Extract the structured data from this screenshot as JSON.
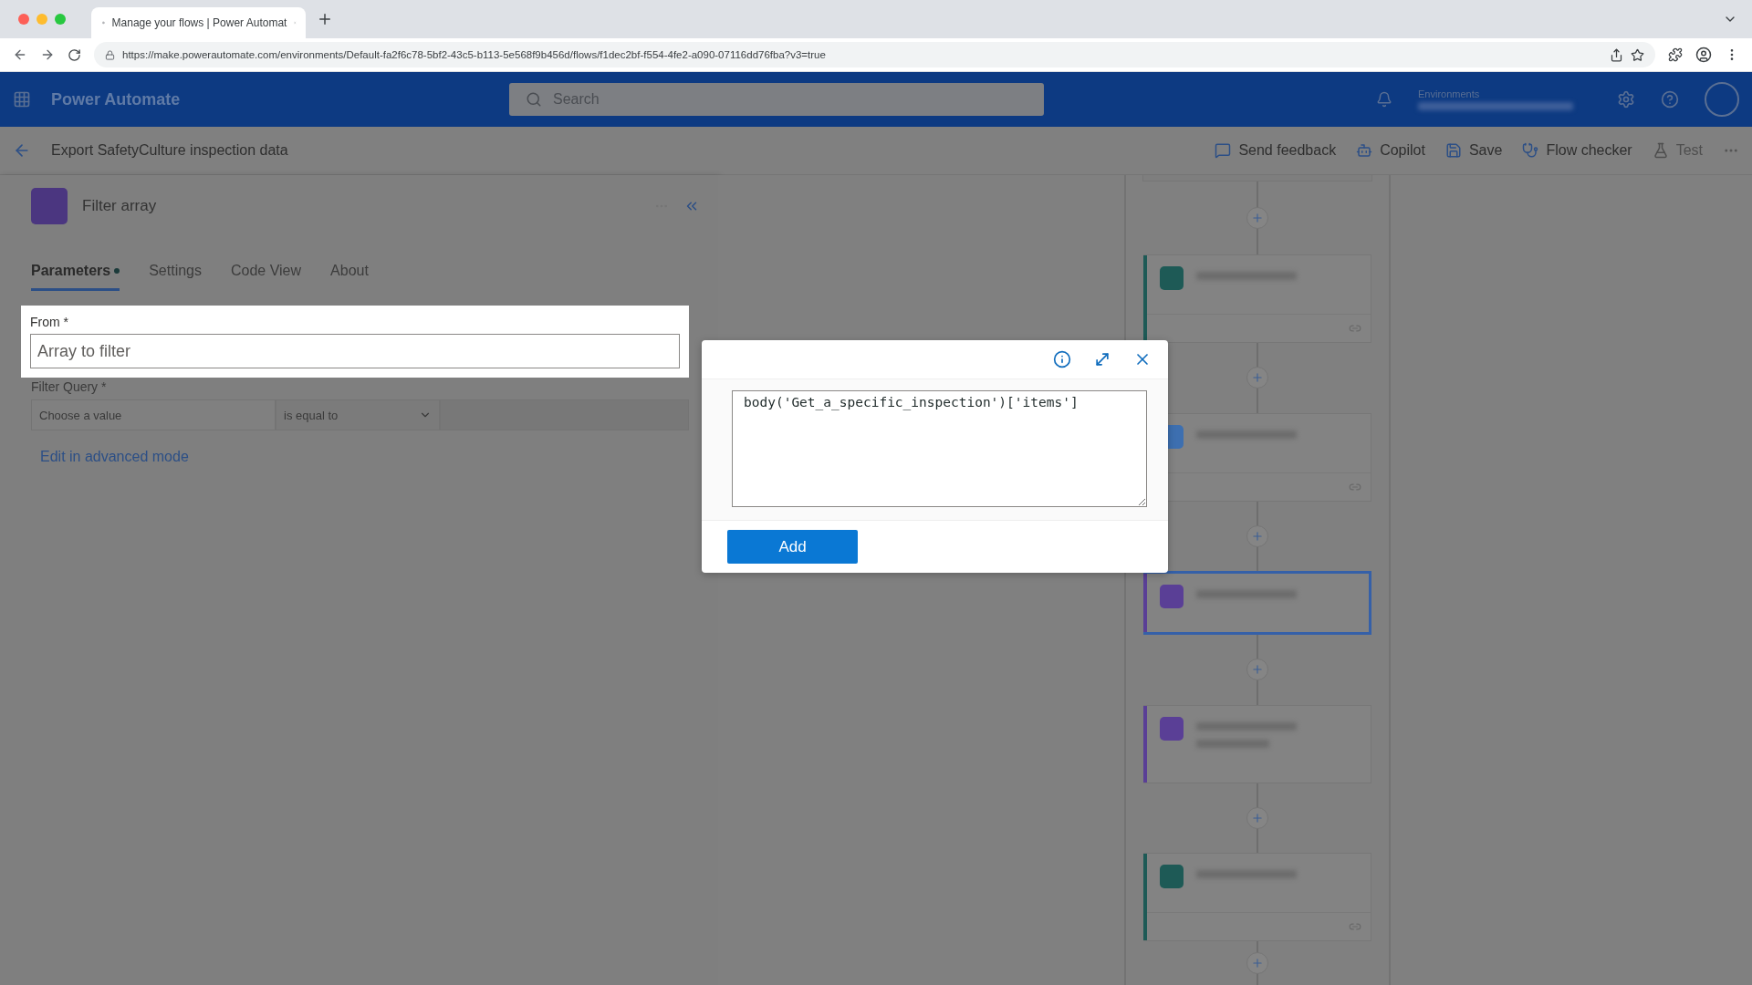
{
  "browser": {
    "tab_title": "Manage your flows | Power Automat",
    "url": "https://make.powerautomate.com/environments/Default-fa2f6c78-5bf2-43c5-b113-5e568f9b456d/flows/f1dec2bf-f554-4fe2-a090-07116dd76fba?v3=true"
  },
  "app_header": {
    "title": "Power Automate",
    "search": {
      "placeholder": "Search"
    },
    "environment_label": "Environments"
  },
  "flow_bar": {
    "title": "Export SafetyCulture inspection data",
    "actions": [
      {
        "kind": "feedback",
        "label": "Send feedback",
        "disabled": false
      },
      {
        "kind": "copilot",
        "label": "Copilot",
        "disabled": false
      },
      {
        "kind": "save",
        "label": "Save",
        "disabled": false
      },
      {
        "kind": "checker",
        "label": "Flow checker",
        "disabled": false
      },
      {
        "kind": "test",
        "label": "Test",
        "disabled": true
      }
    ]
  },
  "panel": {
    "title": "Filter array",
    "tabs": [
      {
        "label": "Parameters",
        "selected": true,
        "modified": true
      },
      {
        "label": "Settings",
        "selected": false,
        "modified": false
      },
      {
        "label": "Code View",
        "selected": false,
        "modified": false
      },
      {
        "label": "About",
        "selected": false,
        "modified": false
      }
    ],
    "from": {
      "label": "From *",
      "placeholder": "Array to filter"
    },
    "filter_query": {
      "label": "Filter Query *",
      "left": {
        "placeholder": "Choose a value"
      },
      "operator": "is equal to"
    },
    "advanced_link": "Edit in advanced mode"
  },
  "expression_popup": {
    "value": "body('Get_a_specific_inspection')['items']",
    "button": "Add"
  },
  "canvas": {
    "nodes": [
      {
        "color": "#1e5a56",
        "selected": false
      },
      {
        "color": "#3d6fb0",
        "selected": false
      },
      {
        "color": "#5a3f96",
        "selected": true
      },
      {
        "color": "#5a3f96",
        "selected": false
      },
      {
        "color": "#1e5a56",
        "selected": false
      }
    ]
  }
}
